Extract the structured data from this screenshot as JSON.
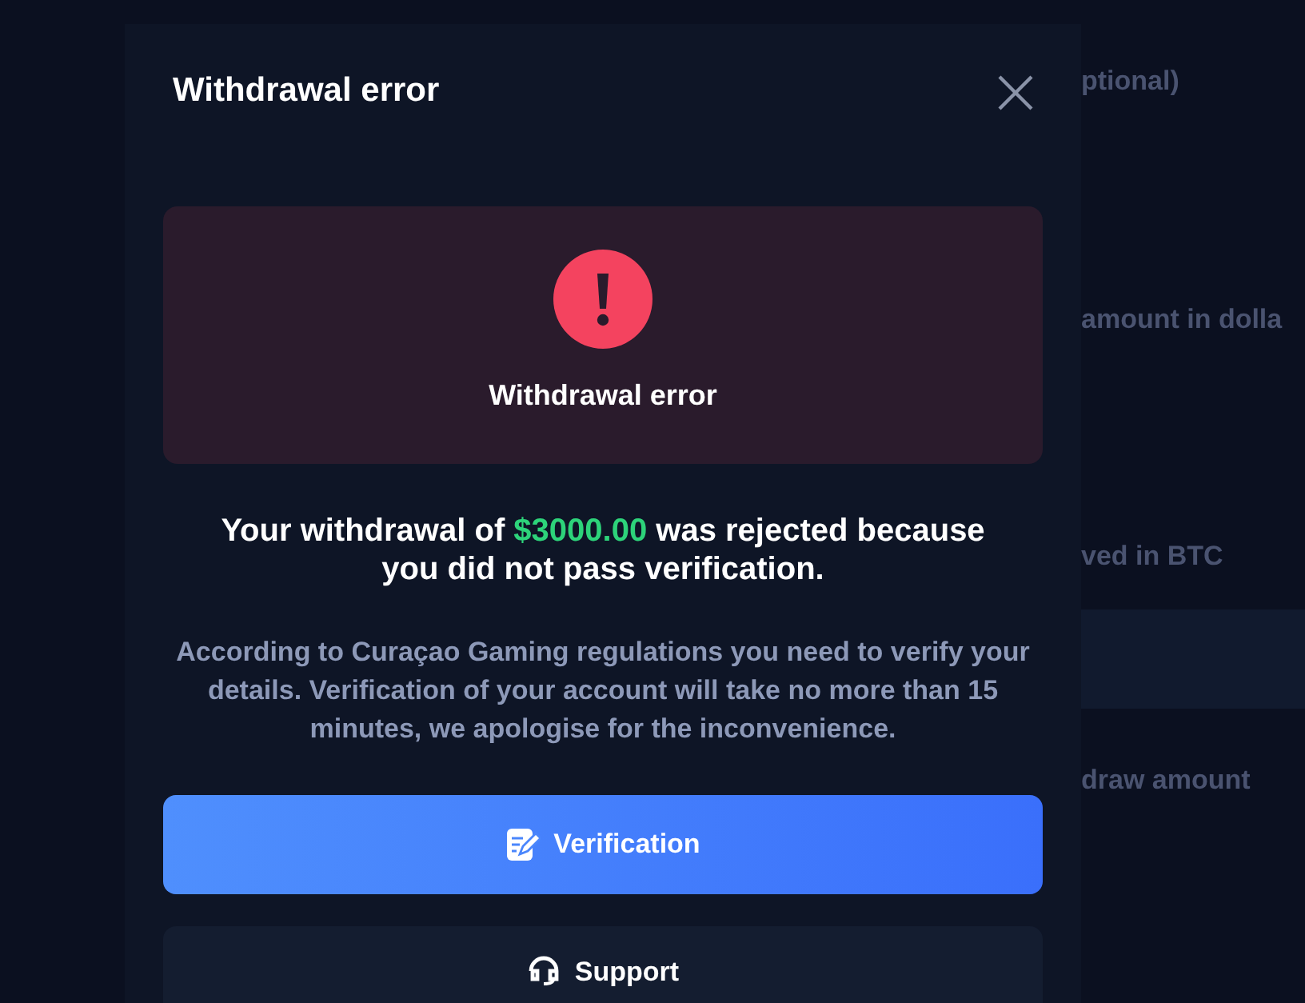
{
  "background": {
    "labels": [
      {
        "text": "ptional)"
      },
      {
        "text": "amount in dolla"
      },
      {
        "text": "ved in BTC"
      },
      {
        "text": "draw amount"
      }
    ]
  },
  "modal": {
    "title": "Withdrawal error",
    "banner_title": "Withdrawal error",
    "message_before": "Your withdrawal of ",
    "amount": "$3000.00",
    "message_after": " was rejected because you did not pass verification.",
    "note": "According to Curaçao Gaming regulations you need to verify your details. Verification of your account will take no more than 15 minutes, we apologise for the inconvenience.",
    "buttons": [
      {
        "label": "Verification",
        "kind": "primary"
      },
      {
        "label": "Support",
        "kind": "secondary"
      }
    ]
  }
}
